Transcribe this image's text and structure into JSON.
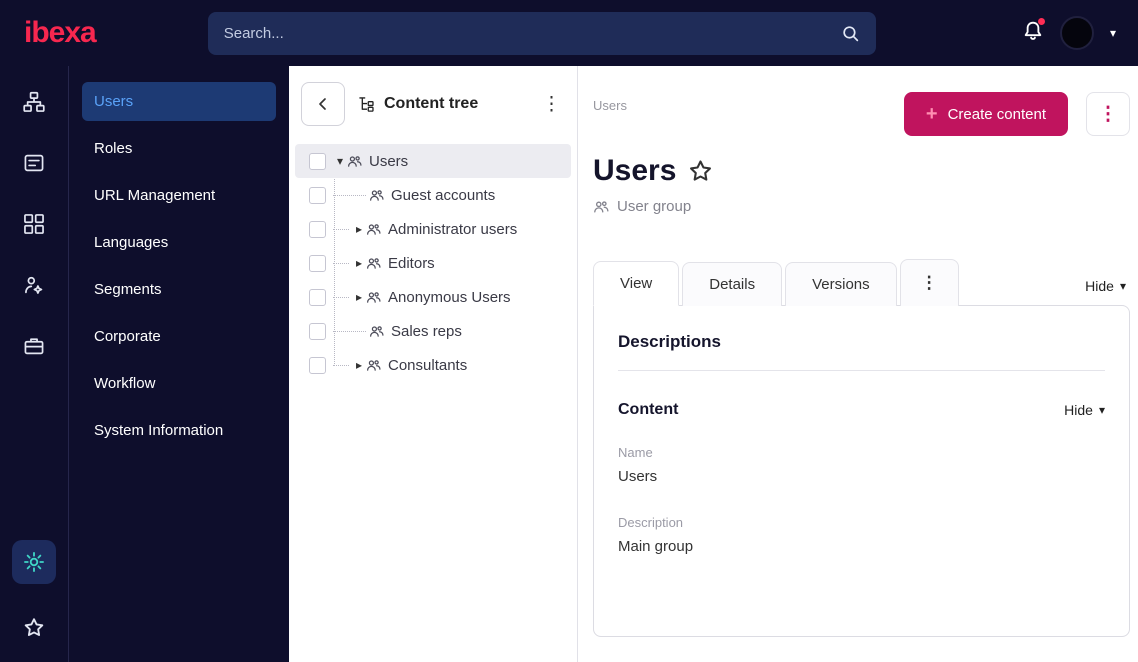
{
  "colors": {
    "topbar_bg": "#0e0e2c",
    "accent_pink": "#c0145e",
    "active_link_blue": "#5aa2f8",
    "settings_teal": "#3fd6c6",
    "logo_red": "#f7274f"
  },
  "glyphs": {
    "caret_down": "▾",
    "caret_right": "▸",
    "kebab": "⋮",
    "plus": "+",
    "dropdown_caret": "▾"
  },
  "topbar": {
    "logo_text": "ibexa",
    "search_placeholder": "Search..."
  },
  "sidebar": {
    "items": [
      {
        "label": "Users",
        "active": true
      },
      {
        "label": "Roles"
      },
      {
        "label": "URL Management"
      },
      {
        "label": "Languages"
      },
      {
        "label": "Segments"
      },
      {
        "label": "Corporate"
      },
      {
        "label": "Workflow"
      },
      {
        "label": "System Information"
      }
    ]
  },
  "content_tree": {
    "title": "Content tree",
    "items": [
      {
        "label": "Users",
        "expanded": true,
        "selected": true
      },
      {
        "label": "Guest accounts"
      },
      {
        "label": "Administrator users",
        "collapsed": true
      },
      {
        "label": "Editors",
        "collapsed": true
      },
      {
        "label": "Anonymous Users",
        "collapsed": true
      },
      {
        "label": "Sales reps"
      },
      {
        "label": "Consultants",
        "collapsed": true
      }
    ]
  },
  "main": {
    "breadcrumb": "Users",
    "create_button_label": "Create content",
    "title": "Users",
    "content_type": "User group",
    "tabs": [
      {
        "label": "View",
        "active": true
      },
      {
        "label": "Details"
      },
      {
        "label": "Versions"
      }
    ],
    "hide_label": "Hide",
    "card": {
      "heading": "Descriptions",
      "section_title": "Content",
      "section_hide_label": "Hide",
      "fields": [
        {
          "label": "Name",
          "value": "Users"
        },
        {
          "label": "Description",
          "value": "Main group"
        }
      ]
    }
  }
}
